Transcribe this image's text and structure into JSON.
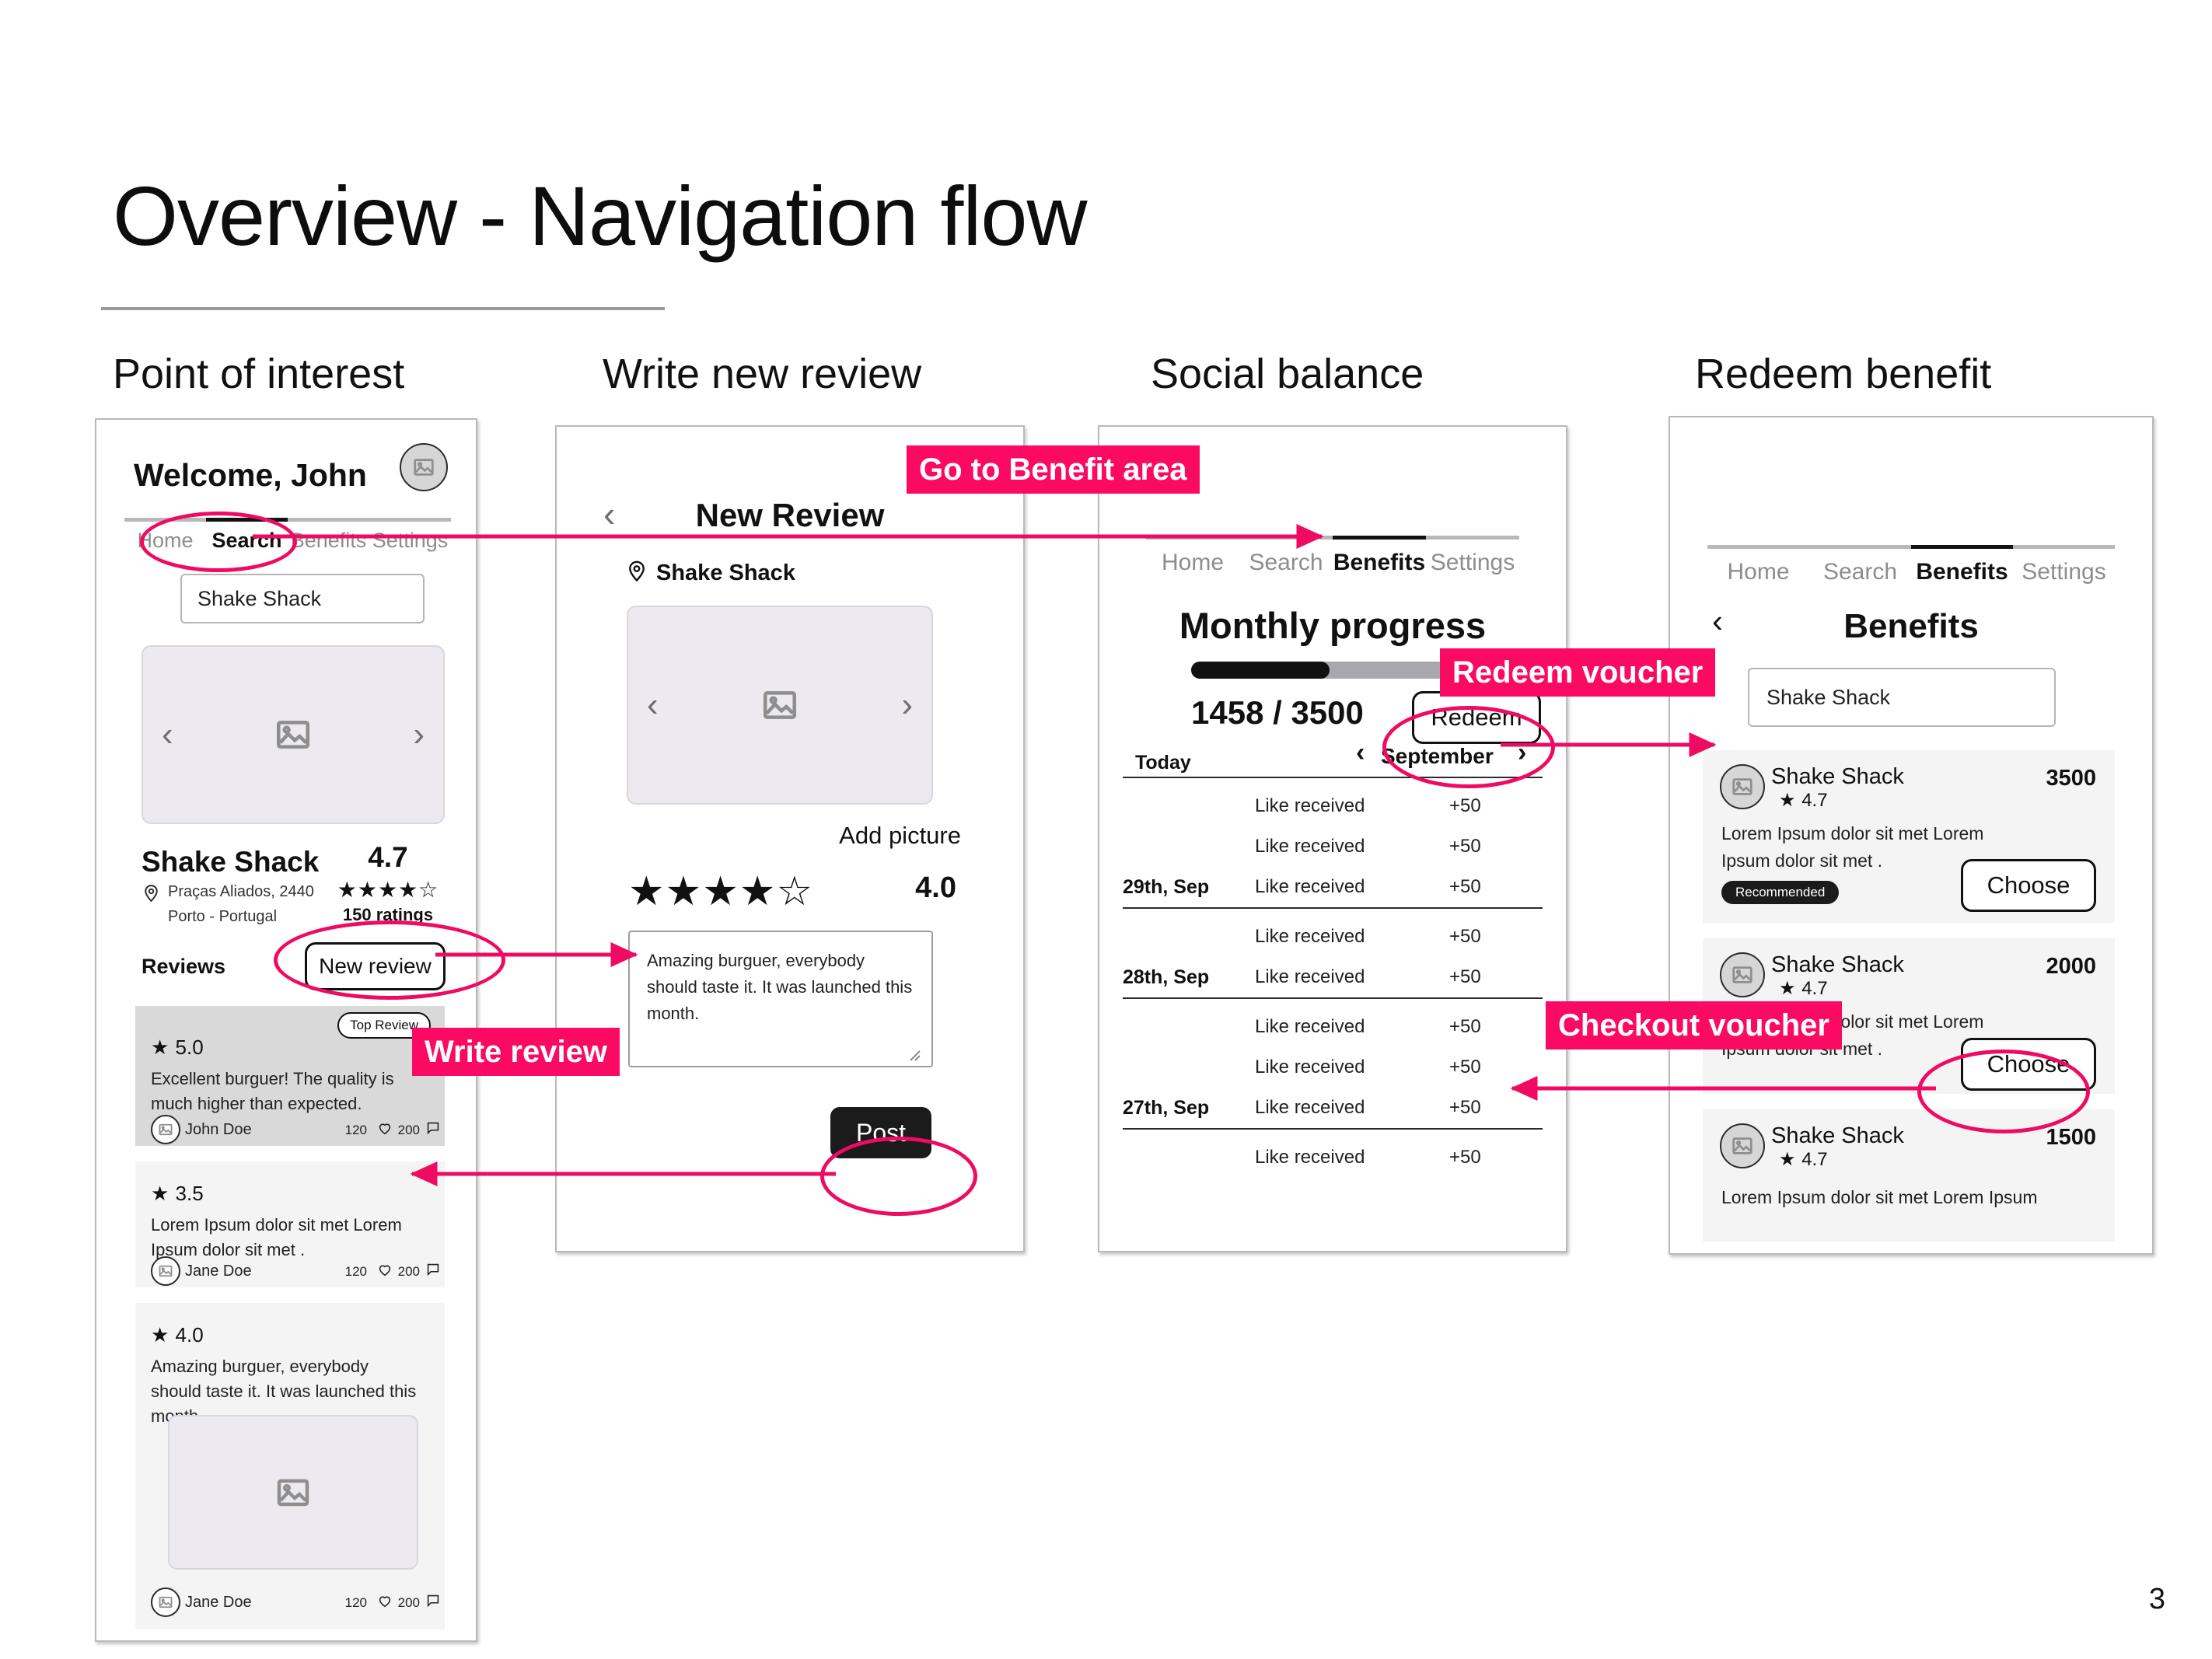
{
  "slide": {
    "title": "Overview - Navigation flow",
    "page_number": "3"
  },
  "columns": [
    {
      "caption": "Point of interest"
    },
    {
      "caption": "Write new review"
    },
    {
      "caption": "Social balance"
    },
    {
      "caption": "Redeem benefit"
    }
  ],
  "annotations": [
    {
      "label": "Go to Benefit area"
    },
    {
      "label": "Write review"
    },
    {
      "label": "Redeem voucher"
    },
    {
      "label": "Checkout voucher"
    }
  ],
  "colors": {
    "accent_pink": "#fa0a62",
    "ink": "#111111",
    "muted": "#8d8d8d",
    "card_grey": "#f4f4f4",
    "card_grey_dark": "#d9d9d9",
    "image_placeholder": "#eceaf0"
  },
  "screen1": {
    "greeting": "Welcome, John",
    "avatar_icon": "image-placeholder-icon",
    "tabs": [
      {
        "label": "Home",
        "active": false
      },
      {
        "label": "Search",
        "active": true
      },
      {
        "label": "Benefits",
        "active": false
      },
      {
        "label": "Settings",
        "active": false
      }
    ],
    "search_value": "Shake Shack",
    "carousel": {
      "prev_icon": "chevron-left-icon",
      "next_icon": "chevron-right-icon",
      "image_icon": "image-placeholder-icon"
    },
    "place": {
      "name": "Shake Shack",
      "address_line1": "Praças Aliados, 2440",
      "address_line2": "Porto - Portugal",
      "pin_icon": "map-pin-icon",
      "rating": "4.7",
      "stars": "★★★★☆",
      "ratings_count": "150 ratings"
    },
    "reviews_heading": "Reviews",
    "new_review_button": "New review",
    "reviews": [
      {
        "score": "5.0",
        "badge": "Top Review",
        "text": "Excellent burguer! The quality is much higher than expected.",
        "author": "John Doe",
        "likes": "120",
        "comments": "200",
        "has_image": false
      },
      {
        "score": "3.5",
        "badge": "",
        "text": "Lorem Ipsum dolor sit met Lorem Ipsum dolor sit met .",
        "author": "Jane Doe",
        "likes": "120",
        "comments": "200",
        "has_image": false
      },
      {
        "score": "4.0",
        "badge": "",
        "text": "Amazing burguer, everybody should taste it. It was launched this month.",
        "author": "Jane Doe",
        "likes": "120",
        "comments": "200",
        "has_image": true
      }
    ]
  },
  "screen2": {
    "back_icon": "chevron-left-icon",
    "title": "New Review",
    "place_name": "Shake Shack",
    "pin_icon": "map-pin-icon",
    "carousel": {
      "prev_icon": "chevron-left-icon",
      "next_icon": "chevron-right-icon",
      "image_icon": "image-placeholder-icon"
    },
    "add_picture_label": "Add picture",
    "stars": "★★★★☆",
    "rating_value": "4.0",
    "review_text": "Amazing burguer, everybody should taste it. It was launched this month.",
    "post_button": "Post"
  },
  "screen3": {
    "tabs": [
      {
        "label": "Home",
        "active": false
      },
      {
        "label": "Search",
        "active": false
      },
      {
        "label": "Benefits",
        "active": true
      },
      {
        "label": "Settings",
        "active": false
      }
    ],
    "progress_title": "Monthly progress",
    "progress_value": 1458,
    "progress_max": 3500,
    "progress_label": "1458 / 3500",
    "redeem_button": "Redeem",
    "month_prev_icon": "chevron-left-icon",
    "month_next_icon": "chevron-right-icon",
    "month": "September",
    "today_label": "Today",
    "transactions": [
      {
        "date": "",
        "label": "Like received",
        "amount": "+50"
      },
      {
        "date": "",
        "label": "Like received",
        "amount": "+50"
      },
      {
        "date": "29th, Sep",
        "label": "Like received",
        "amount": "+50"
      },
      {
        "date": "",
        "label": "Like received",
        "amount": "+50"
      },
      {
        "date": "28th, Sep",
        "label": "Like received",
        "amount": "+50"
      },
      {
        "date": "",
        "label": "Like received",
        "amount": "+50"
      },
      {
        "date": "",
        "label": "Like received",
        "amount": "+50"
      },
      {
        "date": "27th, Sep",
        "label": "Like received",
        "amount": "+50"
      },
      {
        "date": "",
        "label": "Like received",
        "amount": "+50"
      }
    ]
  },
  "screen4": {
    "tabs": [
      {
        "label": "Home",
        "active": false
      },
      {
        "label": "Search",
        "active": false
      },
      {
        "label": "Benefits",
        "active": true
      },
      {
        "label": "Settings",
        "active": false
      }
    ],
    "back_icon": "chevron-left-icon",
    "title": "Benefits",
    "search_value": "Shake Shack",
    "benefits": [
      {
        "name": "Shake Shack",
        "rating": "4.7",
        "points": "3500",
        "description": "Lorem Ipsum dolor sit met Lorem Ipsum dolor sit met .",
        "tag": "Recommended",
        "choose_button": "Choose"
      },
      {
        "name": "Shake Shack",
        "rating": "4.7",
        "points": "2000",
        "description": "Lorem Ipsum dolor sit met Lorem Ipsum dolor sit met .",
        "tag": "",
        "choose_button": "Choose"
      },
      {
        "name": "Shake Shack",
        "rating": "4.7",
        "points": "1500",
        "description": "Lorem Ipsum dolor sit met Lorem Ipsum",
        "tag": "",
        "choose_button": ""
      }
    ]
  }
}
